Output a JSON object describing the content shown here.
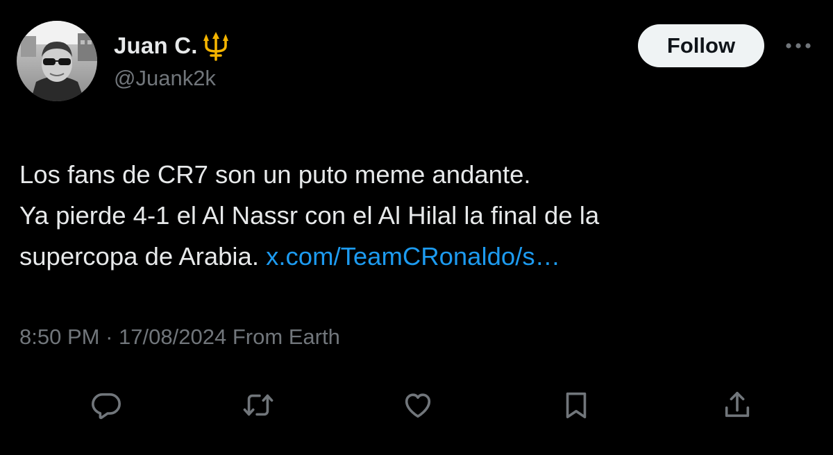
{
  "author": {
    "display_name": "Juan C.",
    "handle": "@Juank2k",
    "name_emoji": "trident-emblem"
  },
  "header": {
    "follow_label": "Follow",
    "more_icon": "more-horizontal-icon"
  },
  "tweet": {
    "line1": "Los fans de CR7 son un puto meme andante.",
    "line2": "Ya pierde 4-1 el Al Nassr con el Al Hilal la final de la",
    "line3_text": "supercopa de Arabia.",
    "link_text": "x.com/TeamCRonaldo/s…"
  },
  "meta": {
    "time": "8:50 PM",
    "separator": "·",
    "date": "17/08/2024",
    "source": "From Earth"
  },
  "actions": {
    "icons": [
      "reply-icon",
      "retweet-icon",
      "like-icon",
      "bookmark-icon",
      "share-icon"
    ]
  },
  "colors": {
    "background": "#000000",
    "text_primary": "#e7e9ea",
    "text_secondary": "#71767b",
    "link": "#1d9bf0",
    "follow_bg": "#eff3f4",
    "trident": "#f4b400"
  }
}
